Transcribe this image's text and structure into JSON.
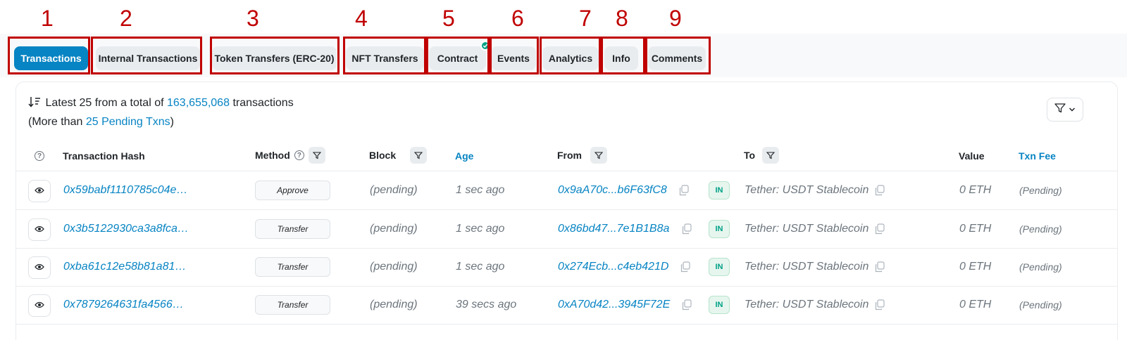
{
  "annotations": [
    "1",
    "2",
    "3",
    "4",
    "5",
    "6",
    "7",
    "8",
    "9"
  ],
  "tabs": [
    {
      "label": "Transactions",
      "active": true
    },
    {
      "label": "Internal Transactions"
    },
    {
      "label": "Token Transfers (ERC-20)"
    },
    {
      "label": "NFT Transfers"
    },
    {
      "label": "Contract",
      "verified": true
    },
    {
      "label": "Events"
    },
    {
      "label": "Analytics"
    },
    {
      "label": "Info"
    },
    {
      "label": "Comments"
    }
  ],
  "summary": {
    "prefix": "Latest 25 from a total of",
    "total": "163,655,068",
    "suffix": "transactions",
    "pending_prefix": "(More than",
    "pending_link": "25 Pending Txns",
    "pending_suffix": ")"
  },
  "columns": {
    "hash": "Transaction Hash",
    "method": "Method",
    "block": "Block",
    "age": "Age",
    "from": "From",
    "to": "To",
    "value": "Value",
    "fee": "Txn Fee"
  },
  "rows": [
    {
      "hash": "0x59babf1110785c04e…",
      "method": "Approve",
      "block": "(pending)",
      "age": "1 sec ago",
      "from": "0x9aA70c...b6F63fC8",
      "direction": "IN",
      "to": "Tether: USDT Stablecoin",
      "value": "0 ETH",
      "fee": "(Pending)"
    },
    {
      "hash": "0x3b5122930ca3a8fca…",
      "method": "Transfer",
      "block": "(pending)",
      "age": "1 sec ago",
      "from": "0x86bd47...7e1B1B8a",
      "direction": "IN",
      "to": "Tether: USDT Stablecoin",
      "value": "0 ETH",
      "fee": "(Pending)"
    },
    {
      "hash": "0xba61c12e58b81a81…",
      "method": "Transfer",
      "block": "(pending)",
      "age": "1 sec ago",
      "from": "0x274Ecb...c4eb421D",
      "direction": "IN",
      "to": "Tether: USDT Stablecoin",
      "value": "0 ETH",
      "fee": "(Pending)"
    },
    {
      "hash": "0x7879264631fa4566…",
      "method": "Transfer",
      "block": "(pending)",
      "age": "39 secs ago",
      "from": "0xA70d42...3945F72E",
      "direction": "IN",
      "to": "Tether: USDT Stablecoin",
      "value": "0 ETH",
      "fee": "(Pending)"
    }
  ],
  "colors": {
    "accent": "#0784c3",
    "annotation": "#c00000",
    "success": "#00a186"
  }
}
